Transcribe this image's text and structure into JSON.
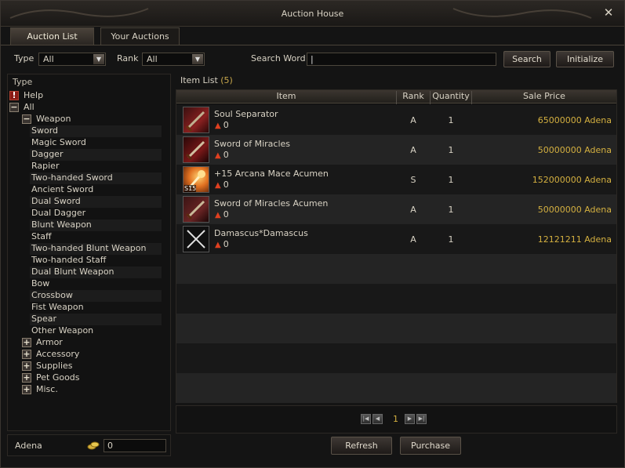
{
  "window": {
    "title": "Auction House",
    "close": "✕"
  },
  "tabs": [
    {
      "label": "Auction List",
      "active": true
    },
    {
      "label": "Your Auctions",
      "active": false
    }
  ],
  "filters": {
    "type_label": "Type",
    "type_value": "All",
    "rank_label": "Rank",
    "rank_value": "All",
    "search_label": "Search Word",
    "search_value": "",
    "search_button": "Search",
    "initialize_button": "Initialize"
  },
  "left": {
    "header": "Type",
    "help": "Help",
    "all": "All",
    "weapon": "Weapon",
    "weapon_items": [
      "Sword",
      "Magic Sword",
      "Dagger",
      "Rapier",
      "Two-handed Sword",
      "Ancient Sword",
      "Dual Sword",
      "Dual Dagger",
      "Blunt Weapon",
      "Staff",
      "Two-handed Blunt Weapon",
      "Two-handed Staff",
      "Dual Blunt Weapon",
      "Bow",
      "Crossbow",
      "Fist Weapon",
      "Spear",
      "Other Weapon"
    ],
    "categories": [
      "Armor",
      "Accessory",
      "Supplies",
      "Pet Goods",
      "Misc."
    ]
  },
  "adena": {
    "label": "Adena",
    "value": "0"
  },
  "list": {
    "title": "Item List",
    "count": "(5)",
    "columns": {
      "item": "Item",
      "rank": "Rank",
      "quantity": "Quantity",
      "price": "Sale Price"
    },
    "rows": [
      {
        "name": "Soul Separator",
        "enchant": "0",
        "rank": "A",
        "qty": "1",
        "price": "65000000 Adena"
      },
      {
        "name": "Sword of Miracles",
        "enchant": "0",
        "rank": "A",
        "qty": "1",
        "price": "50000000 Adena"
      },
      {
        "name": "+15 Arcana Mace Acumen",
        "enchant": "0",
        "rank": "S",
        "qty": "1",
        "price": "152000000 Adena",
        "badge": "S15"
      },
      {
        "name": "Sword of Miracles Acumen",
        "enchant": "0",
        "rank": "A",
        "qty": "1",
        "price": "50000000 Adena"
      },
      {
        "name": "Damascus*Damascus",
        "enchant": "0",
        "rank": "A",
        "qty": "1",
        "price": "12121211 Adena"
      }
    ]
  },
  "pager": {
    "page": "1"
  },
  "actions": {
    "refresh": "Refresh",
    "purchase": "Purchase"
  },
  "colors": {
    "price": "#d4b040",
    "accent": "#c9a84c"
  }
}
